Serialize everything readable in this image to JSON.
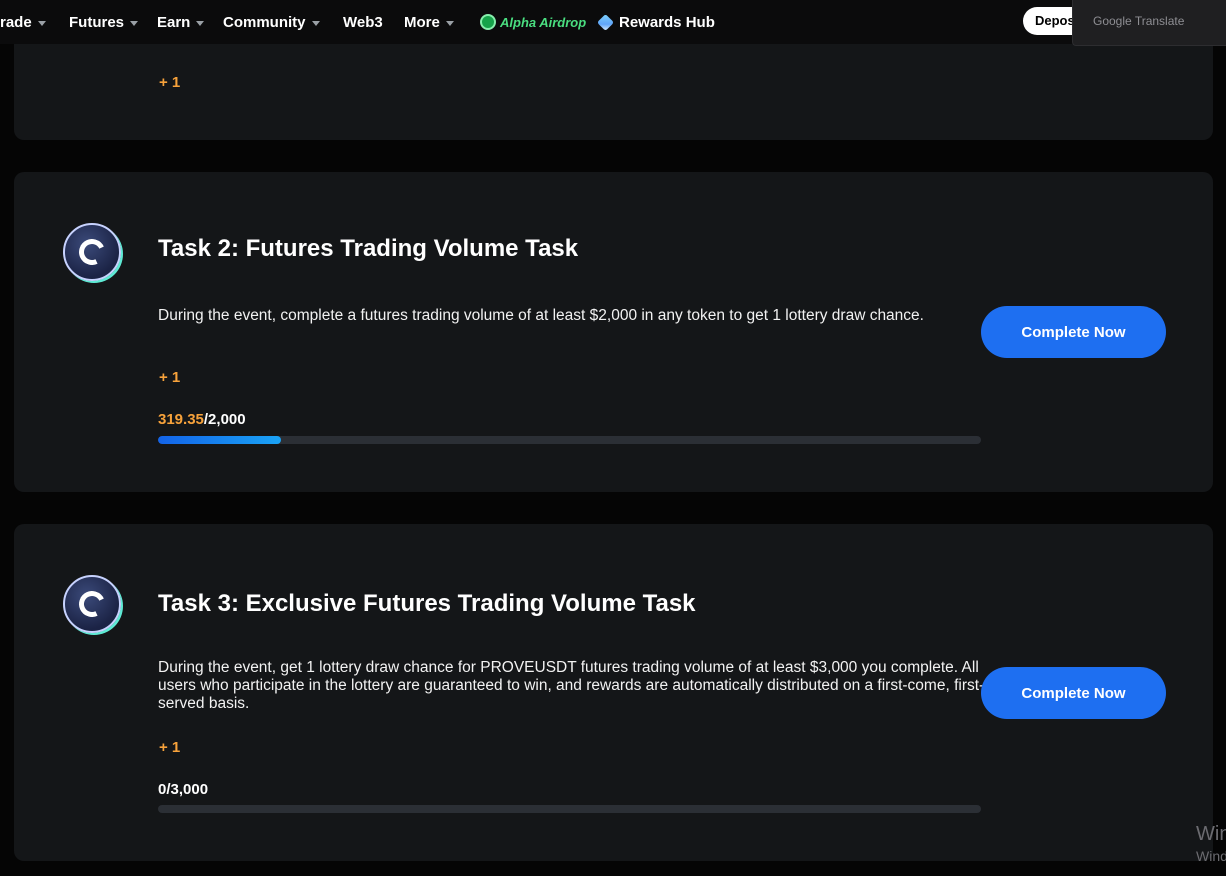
{
  "nav": {
    "items": [
      {
        "label": "rade",
        "caret": true
      },
      {
        "label": "Futures",
        "caret": true
      },
      {
        "label": "Earn",
        "caret": true
      },
      {
        "label": "Community",
        "caret": true
      },
      {
        "label": "Web3",
        "caret": false
      },
      {
        "label": "More",
        "caret": true
      }
    ],
    "alpha_airdrop": "Alpha Airdrop",
    "rewards_hub": "Rewards Hub",
    "deposit": "Deposit"
  },
  "translate": {
    "label": "Google Translate"
  },
  "task1": {
    "reward": "+ 1"
  },
  "task2": {
    "title": "Task 2: Futures Trading Volume Task",
    "description": "During the event, complete a futures trading volume of at least $2,000 in any token to get 1 lottery draw chance.",
    "reward": "+ 1",
    "button": "Complete Now",
    "progress_current": "319.35",
    "progress_target": "/2,000",
    "progress_fraction": 0.15
  },
  "task3": {
    "title": "Task 3: Exclusive Futures Trading Volume Task",
    "description": "During the event, get 1 lottery draw chance for PROVEUSDT futures trading volume of at least $3,000 you complete. All users who participate in the lottery are guaranteed to win, and rewards are automatically distributed on a first-come, first-served basis.",
    "reward": "+ 1",
    "button": "Complete Now",
    "progress_current": "0",
    "progress_target": "/3,000",
    "progress_fraction": 0.0
  },
  "watermark": {
    "line1": "Win",
    "line2": "Wind"
  },
  "colors": {
    "accent": "#1e6ff1",
    "reward": "#f7a23b",
    "card": "#141618"
  }
}
